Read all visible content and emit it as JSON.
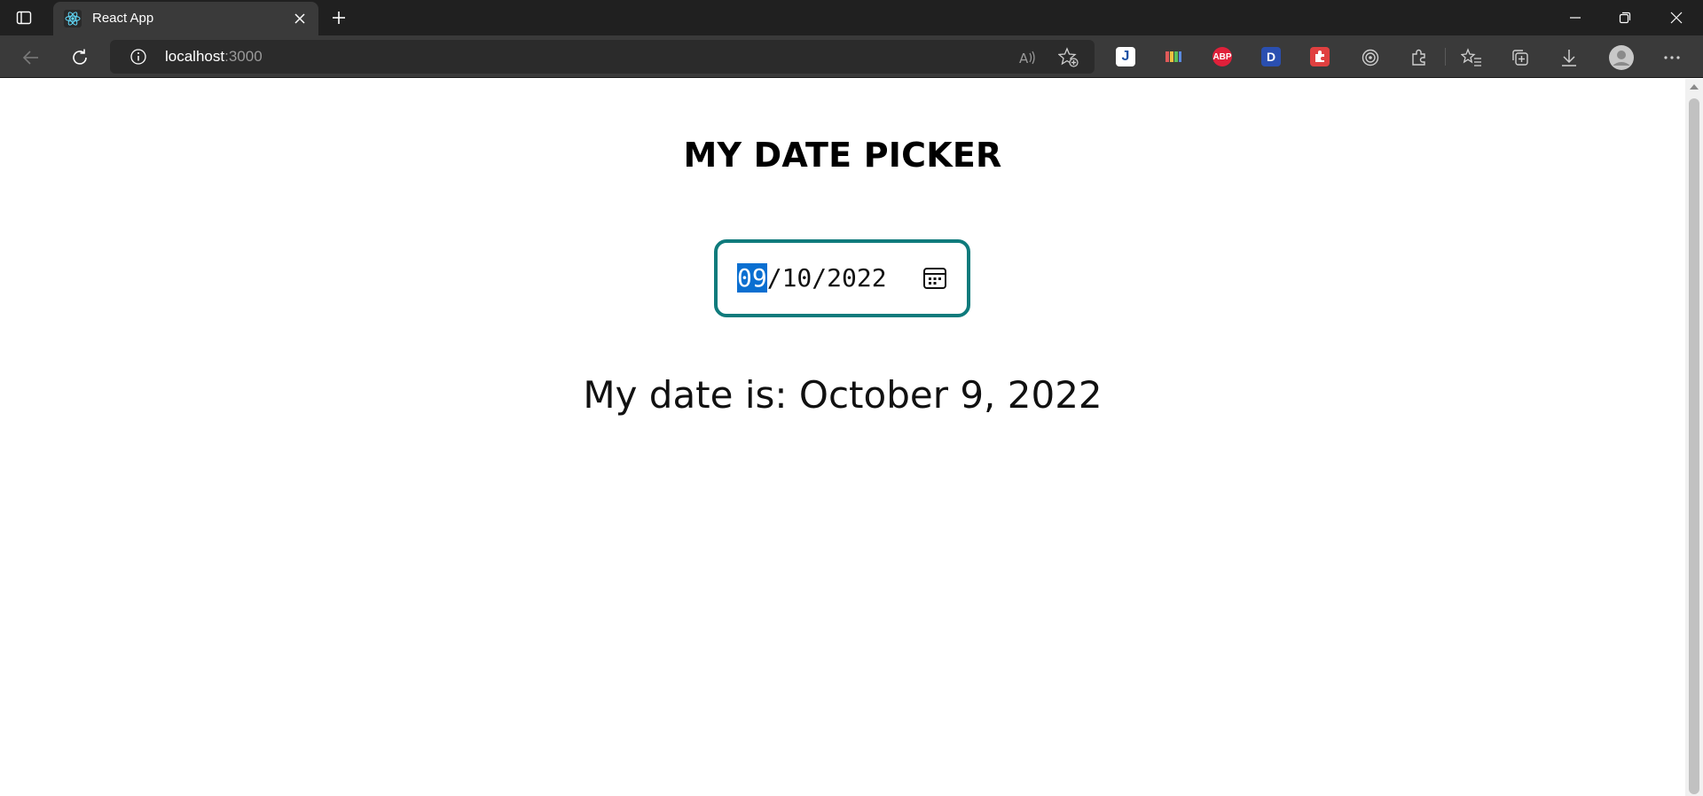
{
  "browser": {
    "tab": {
      "title": "React App",
      "favicon": "react-logo-icon"
    },
    "address": {
      "host": "localhost",
      "port": ":3000"
    },
    "toolbar_icons": [
      "back-icon",
      "refresh-icon",
      "site-info-icon",
      "read-aloud-icon",
      "add-favorite-icon"
    ],
    "extensions": [
      {
        "name": "extension-j-icon",
        "label": "J",
        "color": "#1a4fa3"
      },
      {
        "name": "extension-colorbars-icon",
        "label": "",
        "color": "#333333"
      },
      {
        "name": "extension-adblock-icon",
        "label": "ABP",
        "color": "#e0203a"
      },
      {
        "name": "extension-d-icon",
        "label": "D",
        "color": "#2a4fb0"
      },
      {
        "name": "extension-puzzle-red-icon",
        "label": "",
        "color": "#e04040"
      }
    ]
  },
  "page": {
    "title": "MY DATE PICKER",
    "date_input": {
      "month": "09",
      "sep1": "/",
      "day": "10",
      "sep2": "/",
      "year": "2022",
      "border_color": "#0f7b7c"
    },
    "result": "My date is: October 9, 2022"
  }
}
